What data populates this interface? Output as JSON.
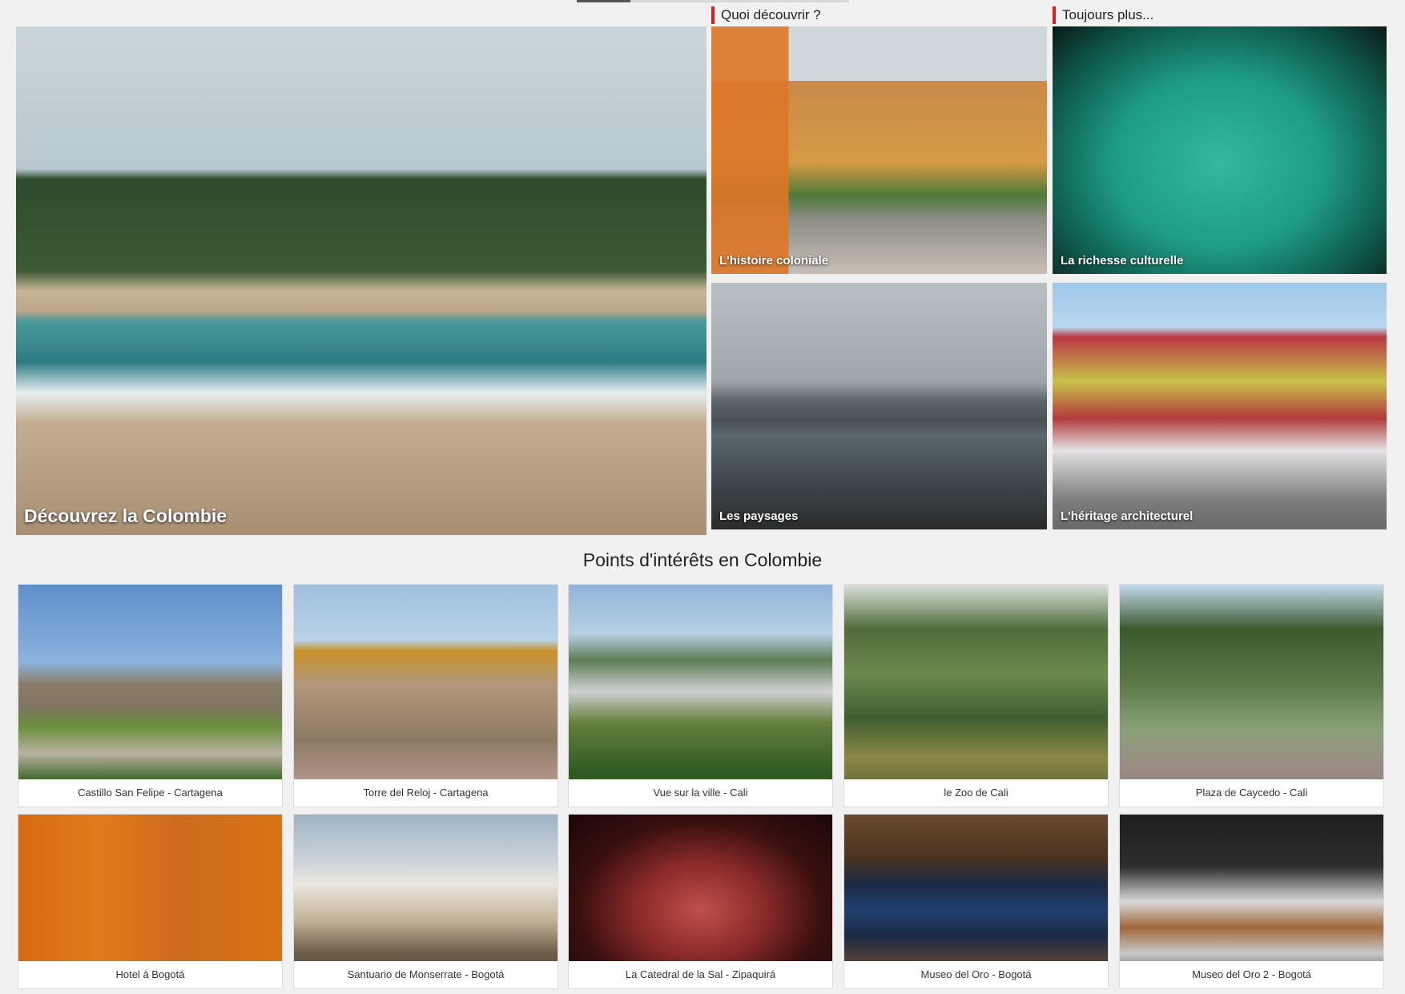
{
  "sections": {
    "quoi": "Quoi découvrir ?",
    "toujours": "Toujours plus..."
  },
  "hero": {
    "caption": "Découvrez la Colombie",
    "tiles": [
      {
        "caption": "L'histoire coloniale"
      },
      {
        "caption": "La richesse culturelle"
      },
      {
        "caption": "Les paysages"
      },
      {
        "caption": "L'héritage architecturel"
      }
    ]
  },
  "poi": {
    "title": "Points d'intérêts en Colombie",
    "items": [
      {
        "label": "Castillo San Felipe - Cartagena"
      },
      {
        "label": "Torre del Reloj - Cartagena"
      },
      {
        "label": "Vue sur la ville - Cali"
      },
      {
        "label": "le Zoo de Cali"
      },
      {
        "label": "Plaza de Caycedo - Cali"
      },
      {
        "label": "Hotel à Bogotá"
      },
      {
        "label": "Santuario de Monserrate - Bogotá"
      },
      {
        "label": "La Catedral de la Sal - Zipaquirá"
      },
      {
        "label": "Museo del Oro - Bogotá"
      },
      {
        "label": "Museo del Oro 2 - Bogotá"
      }
    ]
  },
  "colors": {
    "accent": "#d62020",
    "page_bg": "#f1f1f1"
  }
}
